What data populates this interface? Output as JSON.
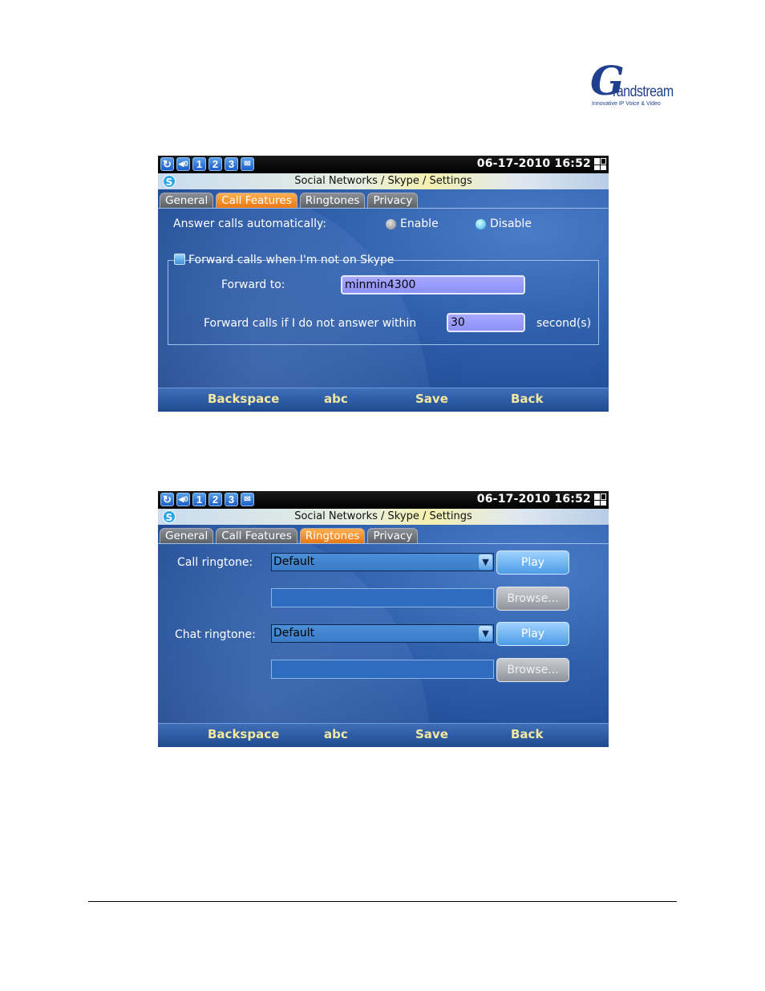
{
  "logo": {
    "letter": "G",
    "word": "randstream",
    "tagline": "Innovative IP Voice & Video"
  },
  "screen1": {
    "status": {
      "icons": [
        "sync-icon",
        "volume-icon",
        "1",
        "2",
        "3",
        "message-icon"
      ],
      "clock": "06-17-2010 16:52"
    },
    "title": "Social Networks / Skype / Settings",
    "tabs": [
      "General",
      "Call Features",
      "Ringtones",
      "Privacy"
    ],
    "active_tab": "Call Features",
    "answer_label": "Answer calls automatically:",
    "enable_label": "Enable",
    "disable_label": "Disable",
    "selected": "Disable",
    "forward_group_label": "Forward calls when I'm not on Skype",
    "forward_to_label": "Forward to:",
    "forward_to_value": "minmin4300",
    "forward_if_label": "Forward calls if I do not answer within",
    "seconds_value": "30",
    "seconds_unit": "second(s)",
    "softkeys": [
      "Backspace",
      "abc",
      "Save",
      "Back"
    ]
  },
  "screen2": {
    "status": {
      "icons": [
        "sync-icon",
        "volume-icon",
        "1",
        "2",
        "3",
        "message-icon"
      ],
      "clock": "06-17-2010 16:52"
    },
    "title": "Social Networks / Skype / Settings",
    "tabs": [
      "General",
      "Call Features",
      "Ringtones",
      "Privacy"
    ],
    "active_tab": "Ringtones",
    "call_ringtone_label": "Call ringtone:",
    "call_ringtone_value": "Default",
    "chat_ringtone_label": "Chat ringtone:",
    "chat_ringtone_value": "Default",
    "play_label": "Play",
    "browse_label": "Browse...",
    "softkeys": [
      "Backspace",
      "abc",
      "Save",
      "Back"
    ]
  },
  "colors": {
    "tab_active": "#e87510",
    "softkey_text": "#f3e8a0",
    "input_purple": "#8d90f6"
  }
}
